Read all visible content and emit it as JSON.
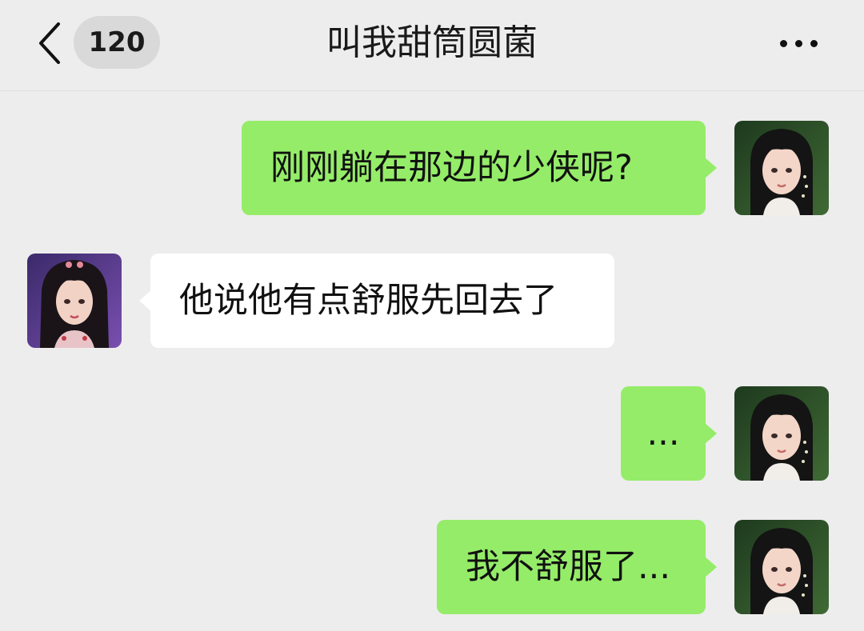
{
  "header": {
    "back_icon": "chevron-left-icon",
    "unread_count": "120",
    "title": "叫我甜筒圆菌",
    "more_icon": "more-horizontal-icon"
  },
  "messages": [
    {
      "side": "out",
      "text": "刚刚躺在那边的少侠呢?",
      "avatar": "avatar-girl-green"
    },
    {
      "side": "in",
      "text": "他说他有点舒服先回去了",
      "avatar": "avatar-girl-purple"
    },
    {
      "side": "out",
      "text": "...",
      "avatar": "avatar-girl-green"
    },
    {
      "side": "out",
      "text": "我不舒服了...",
      "avatar": "avatar-girl-green"
    }
  ],
  "colors": {
    "background": "#ededed",
    "outgoing_bubble": "#95ec69",
    "incoming_bubble": "#ffffff"
  }
}
